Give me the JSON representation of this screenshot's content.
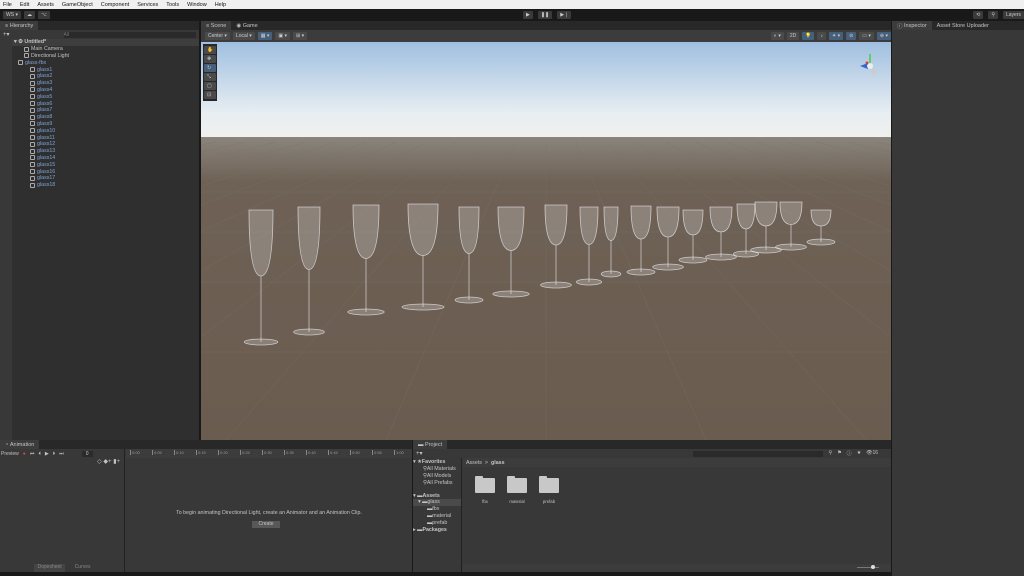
{
  "menu": [
    "File",
    "Edit",
    "Assets",
    "GameObject",
    "Component",
    "Services",
    "Tools",
    "Window",
    "Help"
  ],
  "toolbar": {
    "account": "WS",
    "search_label": "Layers"
  },
  "hierarchy": {
    "tab": "Hierarchy",
    "search_placeholder": "All",
    "scene": "Untitled*",
    "items": [
      "Main Camera",
      "Directional Light"
    ],
    "prefab": "glass-fbx",
    "children": [
      "glass1",
      "glass2",
      "glass3",
      "glass4",
      "glass5",
      "glass6",
      "glass7",
      "glass8",
      "glass9",
      "glass10",
      "glass11",
      "glass12",
      "glass13",
      "glass14",
      "glass15",
      "glass16",
      "glass17",
      "glass18"
    ]
  },
  "scene": {
    "tabs": [
      "Scene",
      "Game"
    ],
    "pivot": "Center",
    "space": "Local",
    "gizmo_label": "2D"
  },
  "inspector": {
    "tabs": [
      "Inspector",
      "Asset Store Uploader"
    ]
  },
  "animation": {
    "tab": "Animation",
    "preview": "Preview",
    "frame": "0",
    "ticks": [
      "0:00",
      "0:05",
      "0:10",
      "0:15",
      "0:20",
      "0:25",
      "0:30",
      "0:35",
      "0:40",
      "0:45",
      "0:50",
      "0:55",
      "1:00"
    ],
    "message": "To begin animating Directional Light, create an Animator and an Animation Clip.",
    "create": "Create",
    "bottom_tabs": [
      "Dopesheet",
      "Curves"
    ]
  },
  "project": {
    "tab": "Project",
    "favorites": "Favorites",
    "fav_items": [
      "All Materials",
      "All Models",
      "All Prefabs"
    ],
    "assets": "Assets",
    "glass": "glass",
    "sub": [
      "fbx",
      "material",
      "prefab"
    ],
    "packages": "Packages",
    "breadcrumb": [
      "Assets",
      "glass"
    ],
    "folders": [
      "fbx",
      "material",
      "prefab"
    ],
    "count": "16"
  }
}
